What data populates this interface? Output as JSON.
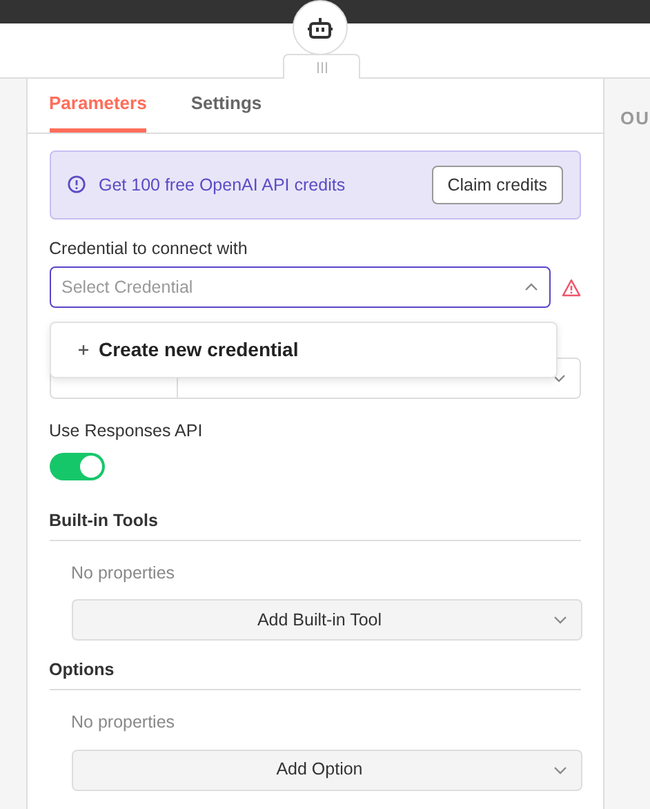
{
  "tabs": [
    {
      "label": "Parameters",
      "selected": true
    },
    {
      "label": "Settings",
      "selected": false
    }
  ],
  "banner": {
    "text": "Get 100 free OpenAI API credits",
    "button": "Claim credits"
  },
  "credential": {
    "label": "Credential to connect with",
    "placeholder": "Select Credential",
    "expanded": true,
    "menu_items": [
      "Create new credential"
    ]
  },
  "use_responses_api": {
    "label": "Use Responses API",
    "on": true
  },
  "sections": [
    {
      "title": "Built-in Tools",
      "empty_text": "No properties",
      "button": "Add Built-in Tool"
    },
    {
      "title": "Options",
      "empty_text": "No properties",
      "button": "Add Option"
    }
  ],
  "output_panel": {
    "title": "OU"
  }
}
